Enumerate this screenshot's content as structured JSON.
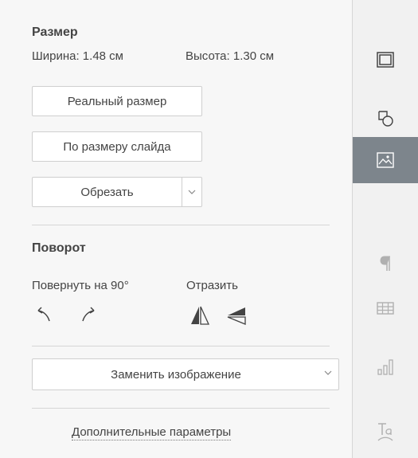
{
  "size": {
    "title": "Размер",
    "width_label": "Ширина: 1.48 см",
    "height_label": "Высота: 1.30 см",
    "actual_size_button": "Реальный размер",
    "fit_slide_button": "По размеру слайда",
    "crop_button": "Обрезать"
  },
  "rotation": {
    "title": "Поворот",
    "rotate_label": "Повернуть на 90°",
    "flip_label": "Отразить"
  },
  "replace_image_button": "Заменить изображение",
  "advanced_settings_link": "Дополнительные параметры",
  "right_rail": {
    "items": [
      {
        "icon": "slide-settings-icon",
        "active": false
      },
      {
        "icon": "shape-settings-icon",
        "active": false
      },
      {
        "icon": "image-settings-icon",
        "active": true
      },
      {
        "icon": "paragraph-settings-icon",
        "active": false
      },
      {
        "icon": "table-settings-icon",
        "active": false
      },
      {
        "icon": "chart-settings-icon",
        "active": false
      },
      {
        "icon": "text-art-settings-icon",
        "active": false
      }
    ]
  },
  "colors": {
    "active_rail": "#7d858c",
    "panel_bg": "#f7f7f7",
    "border": "#cfcfcf"
  }
}
